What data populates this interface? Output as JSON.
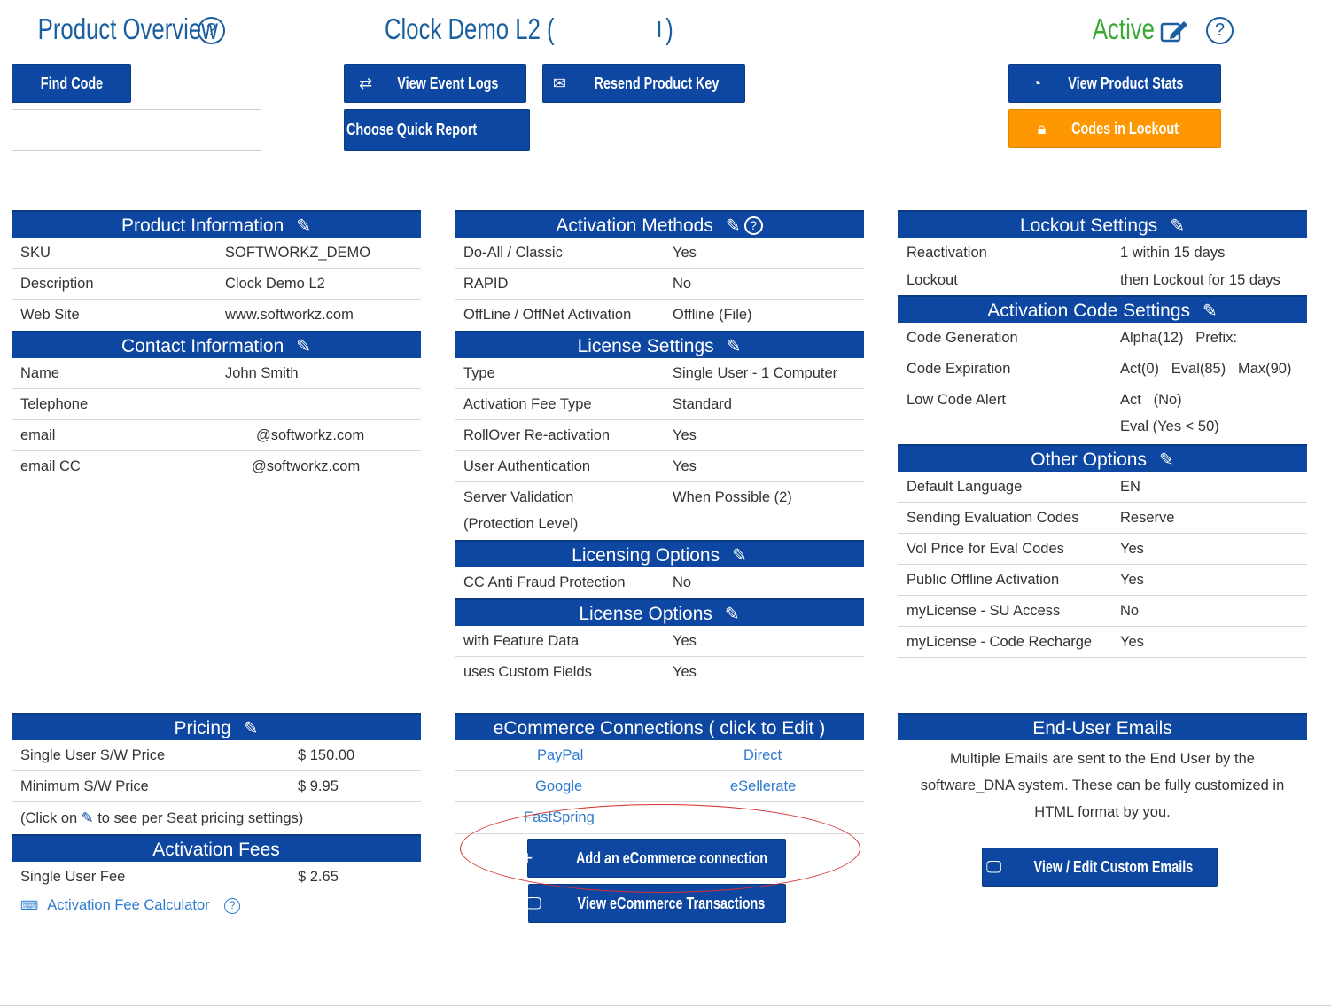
{
  "header": {
    "title": "Product Overview",
    "help": "?",
    "product_name": "Clock Demo L2 (",
    "product_suffix": ")",
    "status": "Active",
    "status_color": "#3aaa35",
    "edit_icon": "edit-icon"
  },
  "buttons": {
    "find_code": "Find Code",
    "view_event_logs": "View Event Logs",
    "resend_product_key": "Resend Product Key",
    "choose_quick_report": "Choose Quick Report",
    "view_product_stats": "View Product Stats",
    "codes_in_lockout": "Codes in Lockout",
    "add_ecommerce": "Add an eCommerce connection",
    "view_ecommerce_transactions": "View eCommerce Transactions",
    "view_edit_emails": "View / Edit Custom Emails"
  },
  "find_code_input": {
    "value": "",
    "placeholder": ""
  },
  "product_information": {
    "title": "Product Information",
    "rows": [
      {
        "k": "SKU",
        "v": "SOFTWORKZ_DEMO"
      },
      {
        "k": "Description",
        "v": "Clock Demo L2"
      },
      {
        "k": "Web Site",
        "v": "www.softworkz.com"
      }
    ]
  },
  "contact_information": {
    "title": "Contact Information",
    "rows": [
      {
        "k": "Name",
        "v": "John Smith"
      },
      {
        "k": "Telephone",
        "v": ""
      },
      {
        "k": "email",
        "v": "@softworkz.com"
      },
      {
        "k": "email CC",
        "v": "@softworkz.com"
      }
    ]
  },
  "activation_methods": {
    "title": "Activation Methods",
    "rows": [
      {
        "k": "Do-All / Classic",
        "v": "Yes"
      },
      {
        "k": "RAPID",
        "v": "No"
      },
      {
        "k": "OffLine / OffNet Activation",
        "v": "Offline (File)"
      }
    ]
  },
  "license_settings": {
    "title": "License Settings",
    "rows": [
      {
        "k": "Type",
        "v": "Single User - 1 Computer"
      },
      {
        "k": "Activation Fee Type",
        "v": "Standard"
      },
      {
        "k": "RollOver Re-activation",
        "v": "Yes"
      },
      {
        "k": "User Authentication",
        "v": "Yes"
      },
      {
        "k": "Server Validation",
        "v": "When Possible (2)",
        "k2": "(Protection Level)"
      }
    ]
  },
  "licensing_options": {
    "title": "Licensing Options",
    "rows": [
      {
        "k": "CC Anti Fraud Protection",
        "v": "No"
      }
    ]
  },
  "license_options": {
    "title": "License Options",
    "rows": [
      {
        "k": "with Feature Data",
        "v": "Yes"
      },
      {
        "k": "uses Custom Fields",
        "v": "Yes"
      }
    ]
  },
  "lockout_settings": {
    "title": "Lockout Settings",
    "rows": [
      {
        "k": "Reactivation",
        "v": "1 within 15 days"
      },
      {
        "k": "Lockout",
        "v": "then Lockout for 15 days"
      }
    ]
  },
  "activation_code_settings": {
    "title": "Activation Code Settings",
    "rows": [
      {
        "k": "Code Generation",
        "v": "Alpha(12)   Prefix:"
      },
      {
        "k": "Code Expiration",
        "v": "Act(0)   Eval(85)   Max(90)"
      },
      {
        "k": "Low Code Alert",
        "v": "Act   (No)",
        "v2": "Eval (Yes < 50)"
      }
    ]
  },
  "other_options": {
    "title": "Other Options",
    "rows": [
      {
        "k": "Default Language",
        "v": "EN"
      },
      {
        "k": "Sending Evaluation Codes",
        "v": "Reserve"
      },
      {
        "k": "Vol Price for Eval Codes",
        "v": "Yes"
      },
      {
        "k": "Public Offline Activation",
        "v": "Yes"
      },
      {
        "k": "myLicense - SU Access",
        "v": "No"
      },
      {
        "k": "myLicense - Code Recharge",
        "v": "Yes"
      }
    ]
  },
  "pricing": {
    "title": "Pricing",
    "rows": [
      {
        "k": "Single User S/W Price",
        "v": "$ 150.00"
      },
      {
        "k": "Minimum S/W Price",
        "v": "$ 9.95"
      }
    ],
    "note_prefix": "(Click on",
    "note_suffix": "to see per Seat pricing settings)"
  },
  "activation_fees": {
    "title": "Activation Fees",
    "rows": [
      {
        "k": "Single User Fee",
        "v": "$ 2.65"
      }
    ],
    "calculator_label": "Activation Fee Calculator"
  },
  "ecommerce": {
    "title": "eCommerce Connections ( click to Edit )",
    "links": [
      "PayPal",
      "Direct",
      "Google",
      "eSellerate",
      "FastSpring"
    ]
  },
  "end_user_emails": {
    "title": "End-User Emails",
    "text": "Multiple Emails are sent to the End User by the software_DNA system. These can be fully customized in HTML format by you."
  },
  "colors": {
    "primary": "#0d47a1",
    "title_blue": "#1c5fa0",
    "accent_orange": "#ff9800",
    "annotation_red": "#d32f2f"
  }
}
